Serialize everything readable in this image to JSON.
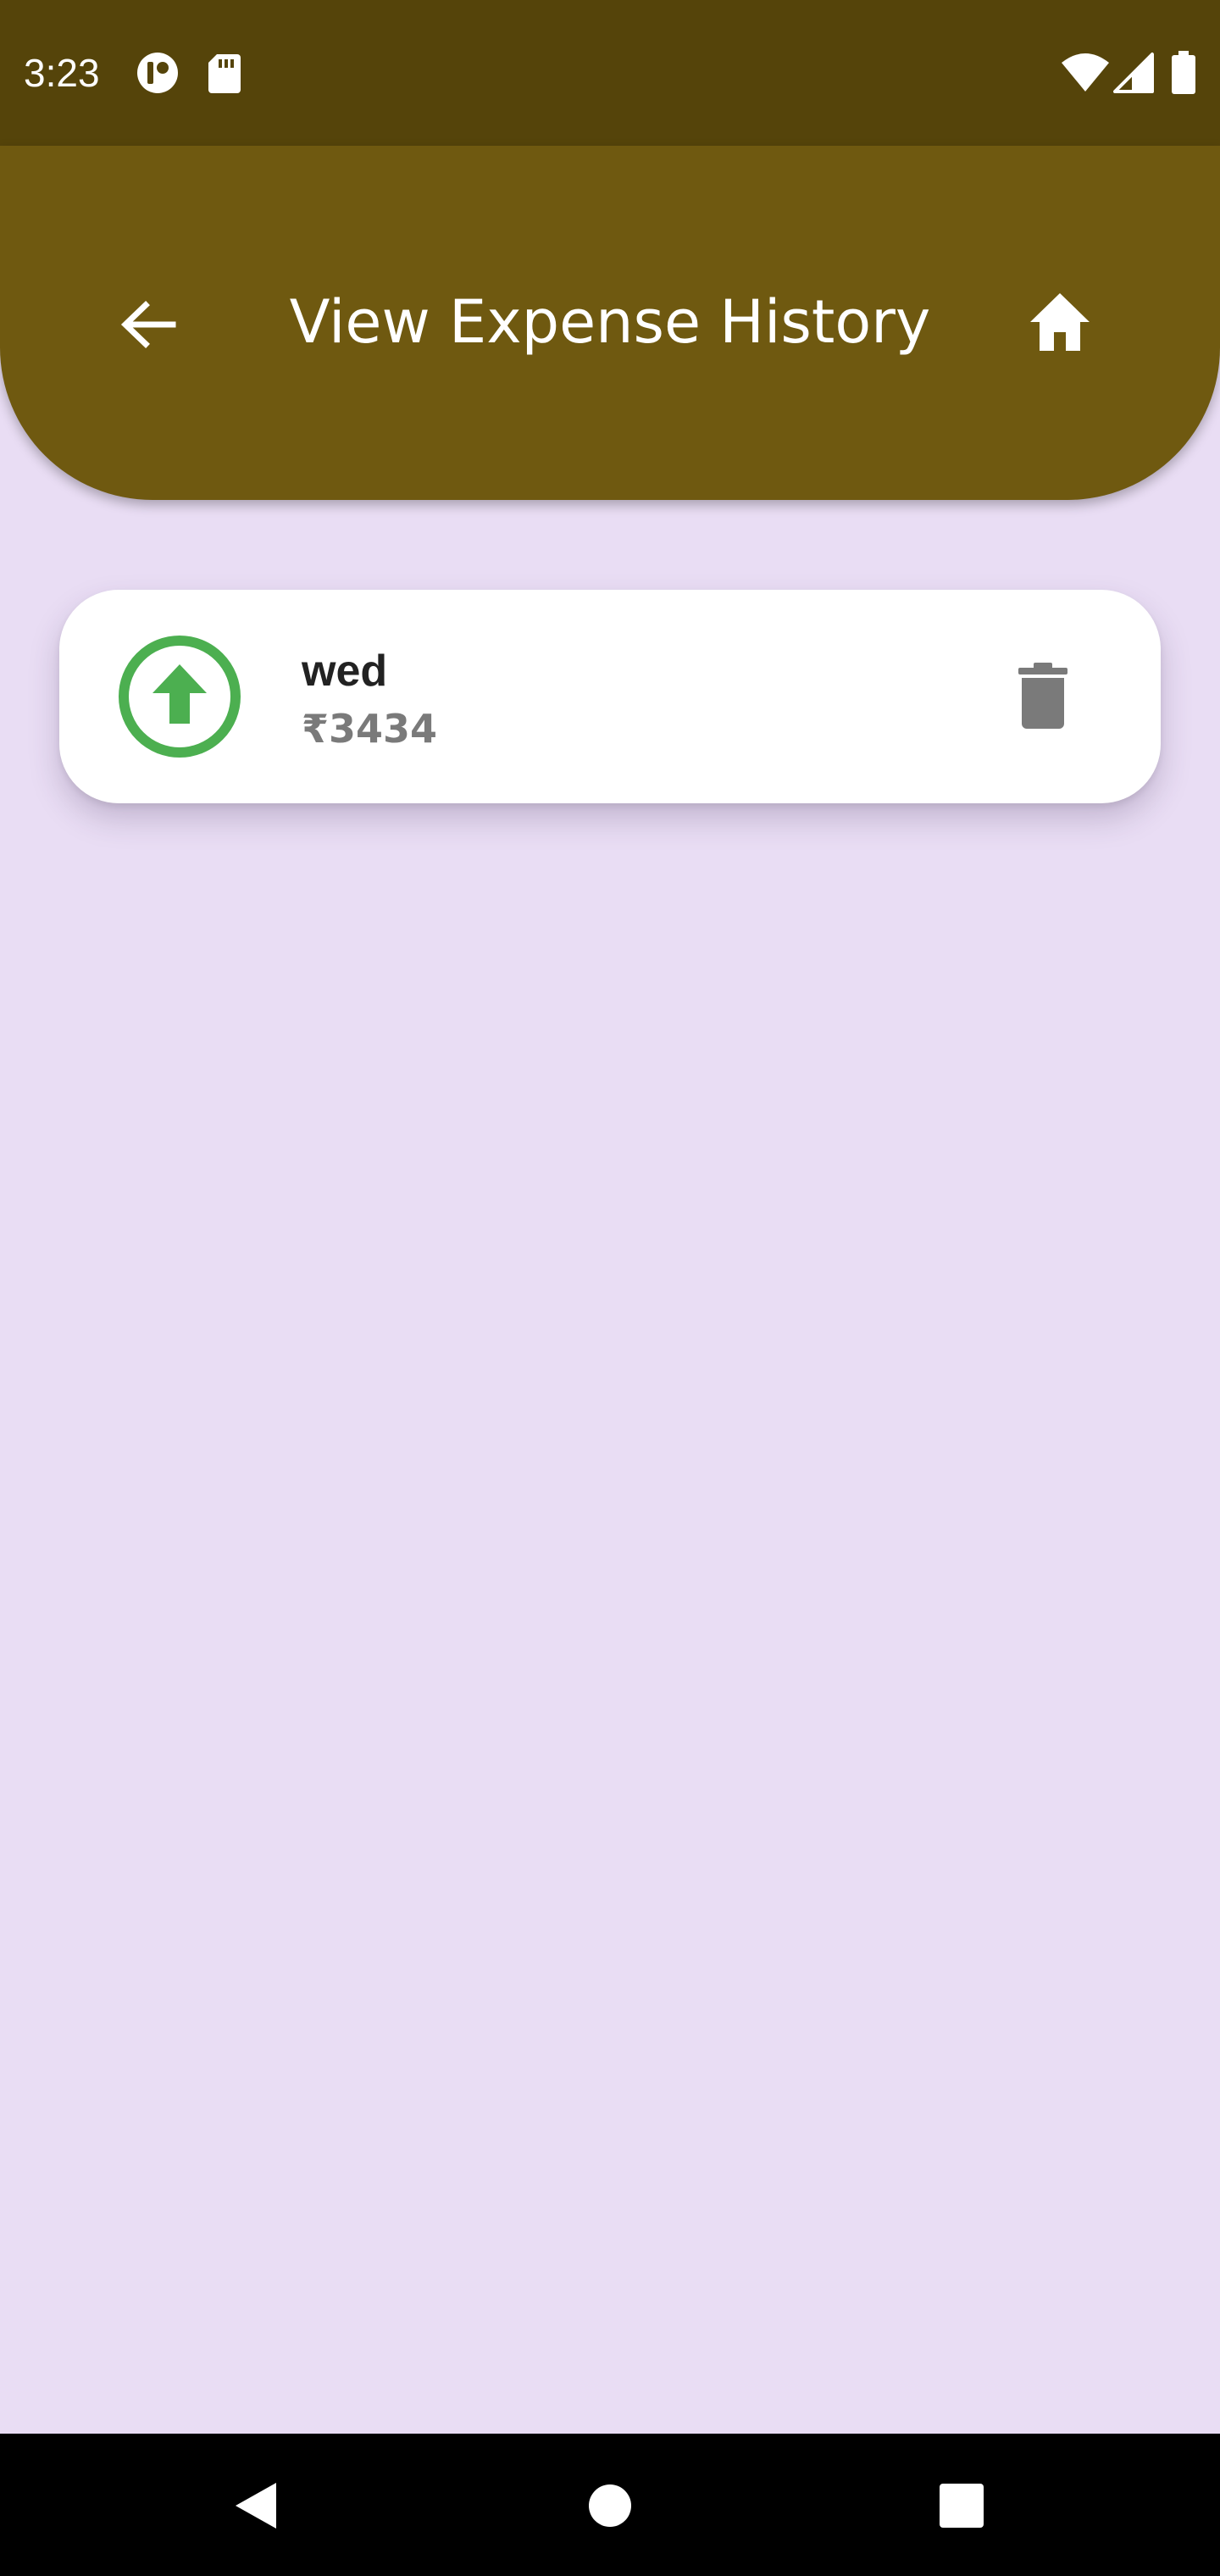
{
  "status_bar": {
    "time": "3:23",
    "left_icons": [
      "notification-app-icon",
      "sd-card-icon"
    ],
    "right_icons": [
      "wifi-icon",
      "cell-signal-icon",
      "battery-icon"
    ]
  },
  "app_bar": {
    "title": "View Expense History",
    "back_icon": "arrow-back-icon",
    "home_icon": "home-icon",
    "color": "#6f5910"
  },
  "expenses": [
    {
      "title": "wed",
      "amount": "₹3434",
      "direction_icon": "arrow-up-circle-icon",
      "direction_color": "#4caf50",
      "action_icon": "delete-icon"
    }
  ],
  "navigation_bar": {
    "buttons": [
      "back-triangle-icon",
      "home-circle-icon",
      "recents-square-icon"
    ]
  },
  "colors": {
    "background": "#e9ddf4",
    "status_bar": "#55440a",
    "card": "#ffffff",
    "delete_icon": "#7a7a7a"
  }
}
